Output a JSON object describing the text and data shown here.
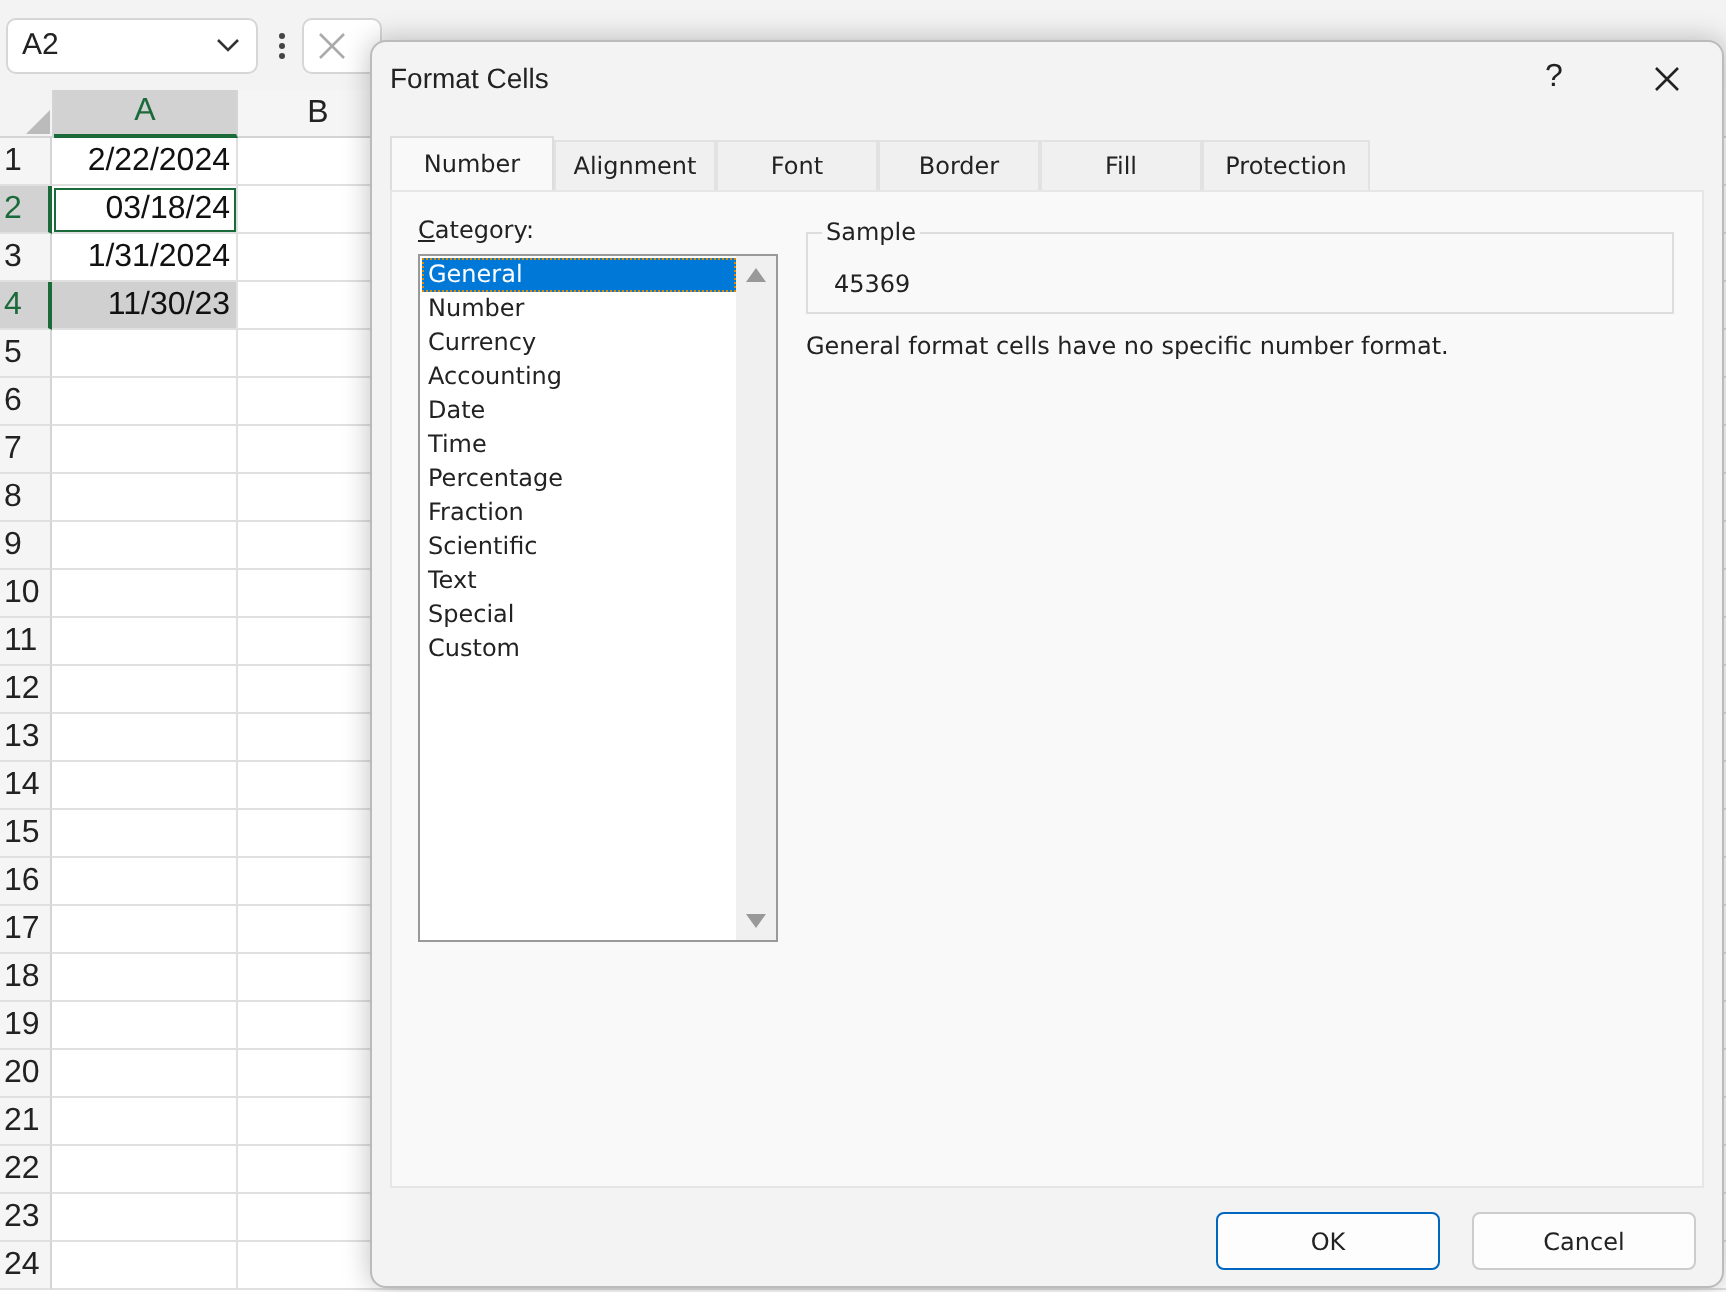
{
  "name_box": {
    "value": "A2"
  },
  "sheet": {
    "columns": [
      {
        "label": "A",
        "selected": true
      },
      {
        "label": "B",
        "selected": false
      }
    ],
    "rows": [
      {
        "number": "1",
        "value": "2/22/2024",
        "selected": false,
        "active": false
      },
      {
        "number": "2",
        "value": "03/18/24",
        "selected": true,
        "active": true
      },
      {
        "number": "3",
        "value": "1/31/2024",
        "selected": false,
        "active": false
      },
      {
        "number": "4",
        "value": "11/30/23",
        "selected": true,
        "active": false
      },
      {
        "number": "5"
      },
      {
        "number": "6"
      },
      {
        "number": "7"
      },
      {
        "number": "8"
      },
      {
        "number": "9"
      },
      {
        "number": "10"
      },
      {
        "number": "11"
      },
      {
        "number": "12"
      },
      {
        "number": "13"
      },
      {
        "number": "14"
      },
      {
        "number": "15"
      },
      {
        "number": "16"
      },
      {
        "number": "17"
      },
      {
        "number": "18"
      },
      {
        "number": "19"
      },
      {
        "number": "20"
      },
      {
        "number": "21"
      },
      {
        "number": "22"
      },
      {
        "number": "23"
      },
      {
        "number": "24"
      }
    ]
  },
  "dialog": {
    "title": "Format Cells",
    "help": "?",
    "tabs": [
      {
        "label": "Number",
        "selected": true
      },
      {
        "label": "Alignment",
        "selected": false
      },
      {
        "label": "Font",
        "selected": false
      },
      {
        "label": "Border",
        "selected": false
      },
      {
        "label": "Fill",
        "selected": false
      },
      {
        "label": "Protection",
        "selected": false
      }
    ],
    "category_label": "Category:",
    "categories": [
      {
        "label": "General",
        "selected": true
      },
      {
        "label": "Number",
        "selected": false
      },
      {
        "label": "Currency",
        "selected": false
      },
      {
        "label": "Accounting",
        "selected": false
      },
      {
        "label": "Date",
        "selected": false
      },
      {
        "label": "Time",
        "selected": false
      },
      {
        "label": "Percentage",
        "selected": false
      },
      {
        "label": "Fraction",
        "selected": false
      },
      {
        "label": "Scientific",
        "selected": false
      },
      {
        "label": "Text",
        "selected": false
      },
      {
        "label": "Special",
        "selected": false
      },
      {
        "label": "Custom",
        "selected": false
      }
    ],
    "sample": {
      "label": "Sample",
      "value": "45369"
    },
    "description": "General format cells have no specific number format.",
    "buttons": [
      {
        "label": "OK",
        "kind": "default"
      },
      {
        "label": "Cancel",
        "kind": "normal"
      }
    ]
  }
}
